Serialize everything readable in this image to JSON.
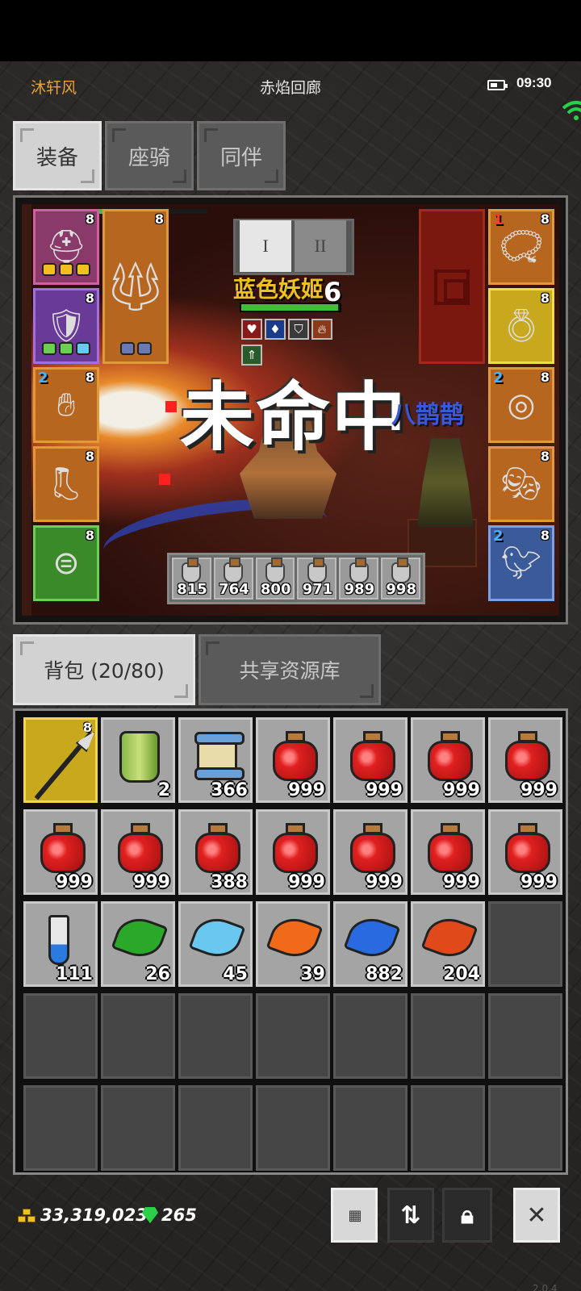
{
  "status": {
    "player_name": "沐轩风",
    "location": "赤焰回廊",
    "time": "09:30",
    "battery_icon": "battery-icon",
    "wifi_icon": "wifi-icon"
  },
  "top_tabs": [
    {
      "label": "装备",
      "active": true
    },
    {
      "label": "座骑",
      "active": false
    },
    {
      "label": "同伴",
      "active": false
    }
  ],
  "battle": {
    "round_buttons": [
      "I",
      "II"
    ],
    "enemy_name": "蓝色妖姬",
    "enemy_count": "6",
    "enemy_hp_fraction": 0.98,
    "miss_text": "未命中",
    "hero_name": "八鹊鹊",
    "left_slots": [
      {
        "icon": "helmet-icon",
        "level": "8",
        "quality": "rare"
      },
      {
        "icon": "armor-icon",
        "level": "8",
        "quality": "epic"
      },
      {
        "icon": "glove-icon",
        "level": "8",
        "tier": "2",
        "quality": "normal"
      },
      {
        "icon": "boots-icon",
        "level": "8",
        "quality": "normal"
      },
      {
        "icon": "belt-icon",
        "level": "8",
        "quality": "green"
      }
    ],
    "weapon_slot": {
      "icon": "trident-icon",
      "level": "8"
    },
    "right_slots": [
      {
        "icon": "amulet-icon",
        "level": "8",
        "tier": "1",
        "quality": "normal"
      },
      {
        "icon": "ring-icon",
        "level": "8",
        "quality": "gold"
      },
      {
        "icon": "earring-icon",
        "level": "8",
        "tier": "2",
        "quality": "normal"
      },
      {
        "icon": "mask-icon",
        "level": "8",
        "quality": "normal"
      },
      {
        "icon": "pet-icon",
        "level": "8",
        "tier": "2",
        "quality": "blue"
      }
    ],
    "potions": [
      "815",
      "764",
      "800",
      "971",
      "989",
      "998"
    ]
  },
  "bag_tabs": [
    {
      "label": "背包 (20/80)",
      "active": true
    },
    {
      "label": "共享资源库",
      "active": false
    }
  ],
  "bag_items": [
    {
      "type": "spear",
      "icon": "spear-icon",
      "level": "8",
      "count": "",
      "selected": true
    },
    {
      "type": "bag",
      "icon": "bag-icon",
      "count": "2"
    },
    {
      "type": "scroll",
      "icon": "scroll-icon",
      "count": "366"
    },
    {
      "type": "red-potion",
      "icon": "red-potion-icon",
      "count": "999"
    },
    {
      "type": "red-potion",
      "icon": "red-potion-icon",
      "count": "999"
    },
    {
      "type": "red-potion",
      "icon": "red-potion-icon",
      "count": "999"
    },
    {
      "type": "red-potion",
      "icon": "red-potion-icon",
      "count": "999"
    },
    {
      "type": "red-potion",
      "icon": "red-potion-icon",
      "count": "999"
    },
    {
      "type": "red-potion",
      "icon": "red-potion-icon",
      "count": "999"
    },
    {
      "type": "red-potion",
      "icon": "red-potion-icon",
      "count": "388"
    },
    {
      "type": "red-potion",
      "icon": "red-potion-icon",
      "count": "999"
    },
    {
      "type": "red-potion",
      "icon": "red-potion-icon",
      "count": "999"
    },
    {
      "type": "red-potion",
      "icon": "red-potion-icon",
      "count": "999"
    },
    {
      "type": "red-potion",
      "icon": "red-potion-icon",
      "count": "999"
    },
    {
      "type": "vial",
      "icon": "blue-vial-icon",
      "count": "111"
    },
    {
      "type": "leaf",
      "icon": "green-leaf-icon",
      "color": "#2aa82a",
      "count": "26"
    },
    {
      "type": "leaf",
      "icon": "ice-leaf-icon",
      "color": "#6ac8f0",
      "count": "45"
    },
    {
      "type": "leaf",
      "icon": "flame-leaf-icon",
      "color": "#f06a1a",
      "count": "39"
    },
    {
      "type": "leaf",
      "icon": "blue-leaf-icon",
      "color": "#2a6ae0",
      "count": "882"
    },
    {
      "type": "leaf",
      "icon": "red-leaf-icon",
      "color": "#e04a1a",
      "count": "204"
    }
  ],
  "bag_capacity_visible": 35,
  "currency": {
    "gold": "33,319,023",
    "gems": "265"
  },
  "tools": [
    {
      "icon": "grid-icon",
      "glyph": "⋮⋮⋮",
      "style": "light"
    },
    {
      "icon": "sort-icon",
      "glyph": "⇅",
      "style": "dark"
    },
    {
      "icon": "lock-icon",
      "glyph": "🔒︎",
      "style": "dark"
    },
    {
      "icon": "close-icon",
      "glyph": "✕",
      "style": "light"
    }
  ],
  "version": "2.0.4"
}
